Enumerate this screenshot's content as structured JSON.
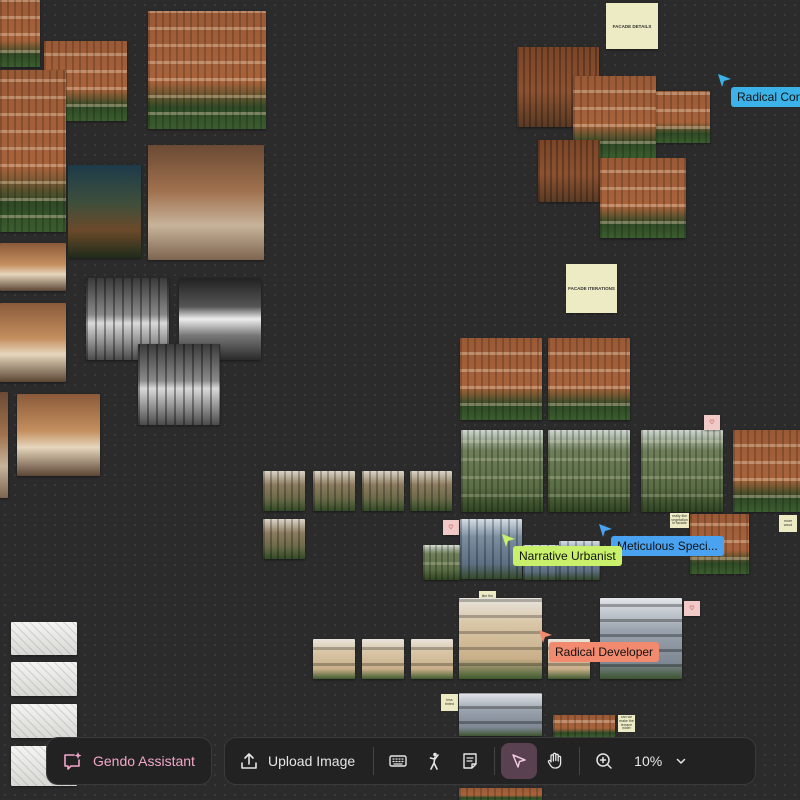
{
  "canvas": {
    "notes": {
      "facade_details": "FACADE DETAILS",
      "facade_iterations": "FACADE ITERATIONS"
    },
    "mini_notes": [
      "really like vegetation in facade",
      "more wood",
      "like the balcony",
      "less tinted",
      "can we make the terrace wider"
    ],
    "cursors": {
      "radical_cons": {
        "label": "Radical Cons",
        "color": "#3bb3e8"
      },
      "meticulous": {
        "label": "Meticulous Speci...",
        "color": "#4aa3f0"
      },
      "narrative": {
        "label": "Narrative Urbanist",
        "color": "#c8f06a"
      },
      "radical_dev": {
        "label": "Radical Developer",
        "color": "#f28a70"
      }
    }
  },
  "assistant": {
    "label": "Gendo Assistant",
    "icon": "sparkle-chat-icon",
    "accent": "#f2a7c9"
  },
  "toolbar": {
    "upload_label": "Upload Image",
    "zoom_value": "10%",
    "icons": [
      "upload-icon",
      "keyboard-icon",
      "figure-icon",
      "note-icon",
      "pointer-icon",
      "hand-icon",
      "zoom-icon",
      "chevron-down-icon"
    ]
  }
}
